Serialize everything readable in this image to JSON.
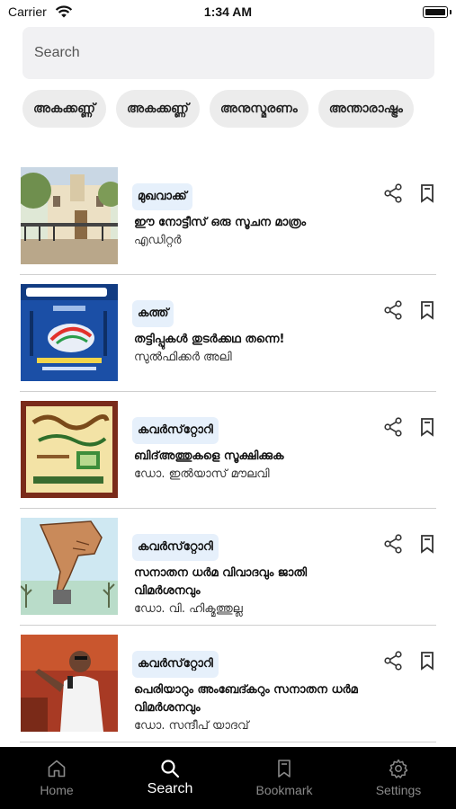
{
  "status_bar": {
    "carrier": "Carrier",
    "time": "1:34 AM"
  },
  "search": {
    "placeholder": "Search"
  },
  "chips": [
    "അകക്കണ്ണ്",
    "അകക്കണ്ണ്",
    "അനുസ്മരണം",
    "അന്താരാഷ്ട്രം"
  ],
  "articles": [
    {
      "category": "മുഖവാക്ക്",
      "title": "ഈ നോട്ടീസ് ഒരു സൂചന മാത്രം",
      "author": "എഡിറ്റർ"
    },
    {
      "category": "കത്ത്",
      "title": "തട്ടിപ്പുകൾ തുടർക്കഥ തന്നെ!",
      "author": "സുൽഫിക്കർ അലി"
    },
    {
      "category": "കവർസ്‌റ്റോറി",
      "title": "ബിദ്അത്തുകളെ സൂക്ഷിക്കുക",
      "author": "ഡോ. ഇൽയാസ് മൗലവി"
    },
    {
      "category": "കവർസ്‌റ്റോറി",
      "title": "സനാതന ധർമ വിവാദവും ജാതി വിമർശനവും",
      "author": "ഡോ. വി. ഹിക്മത്തുല്ല"
    },
    {
      "category": "കവർസ്‌റ്റോറി",
      "title": "പെരിയാറും അംബേദ്കറും സനാതന ധർമ വിമർശനവും",
      "author": "ഡോ. സന്ദീപ് യാദവ്"
    }
  ],
  "tabs": [
    {
      "label": "Home",
      "icon": "home-icon"
    },
    {
      "label": "Search",
      "icon": "search-icon",
      "active": true
    },
    {
      "label": "Bookmark",
      "icon": "bookmark-icon"
    },
    {
      "label": "Settings",
      "icon": "gear-icon"
    }
  ],
  "colors": {
    "accent_chip": "#e6f0fb",
    "tab_bar": "#000000",
    "tab_inactive": "#8a8a8a",
    "tab_active": "#ffffff"
  }
}
